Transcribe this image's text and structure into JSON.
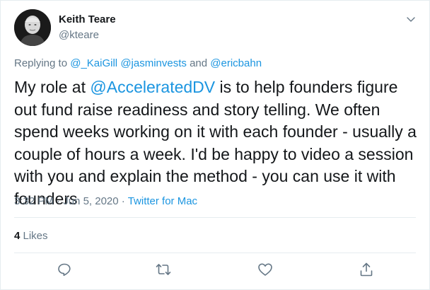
{
  "tweet": {
    "author_name": "Keith Teare",
    "author_handle": "@kteare",
    "reply_prefix": "Replying to",
    "reply_mentions": [
      "@_KaiGill",
      "@jasminvests",
      "@ericbahn"
    ],
    "reply_separator_1": " ",
    "reply_separator_2": " and ",
    "text_before": "My role at ",
    "text_mention": "@AcceleratedDV",
    "text_after": " is to help founders figure out fund raise readiness and story telling. We often spend weeks working on it with each founder - usually a couple of hours a week. I'd be happy to video a session with you and explain the method - you can use it with founders",
    "time": "3:32 PM",
    "date": "Jun 5, 2020",
    "dot": " · ",
    "source": "Twitter for Mac",
    "likes_count": "4",
    "likes_label": " Likes"
  },
  "icons": {
    "reply": "reply-icon",
    "retweet": "retweet-icon",
    "like": "heart-icon",
    "share": "share-icon",
    "caret": "chevron-down-icon"
  },
  "colors": {
    "text": "#14171a",
    "secondary": "#657786",
    "link": "#1b95e0",
    "border": "#e6ecf0"
  }
}
